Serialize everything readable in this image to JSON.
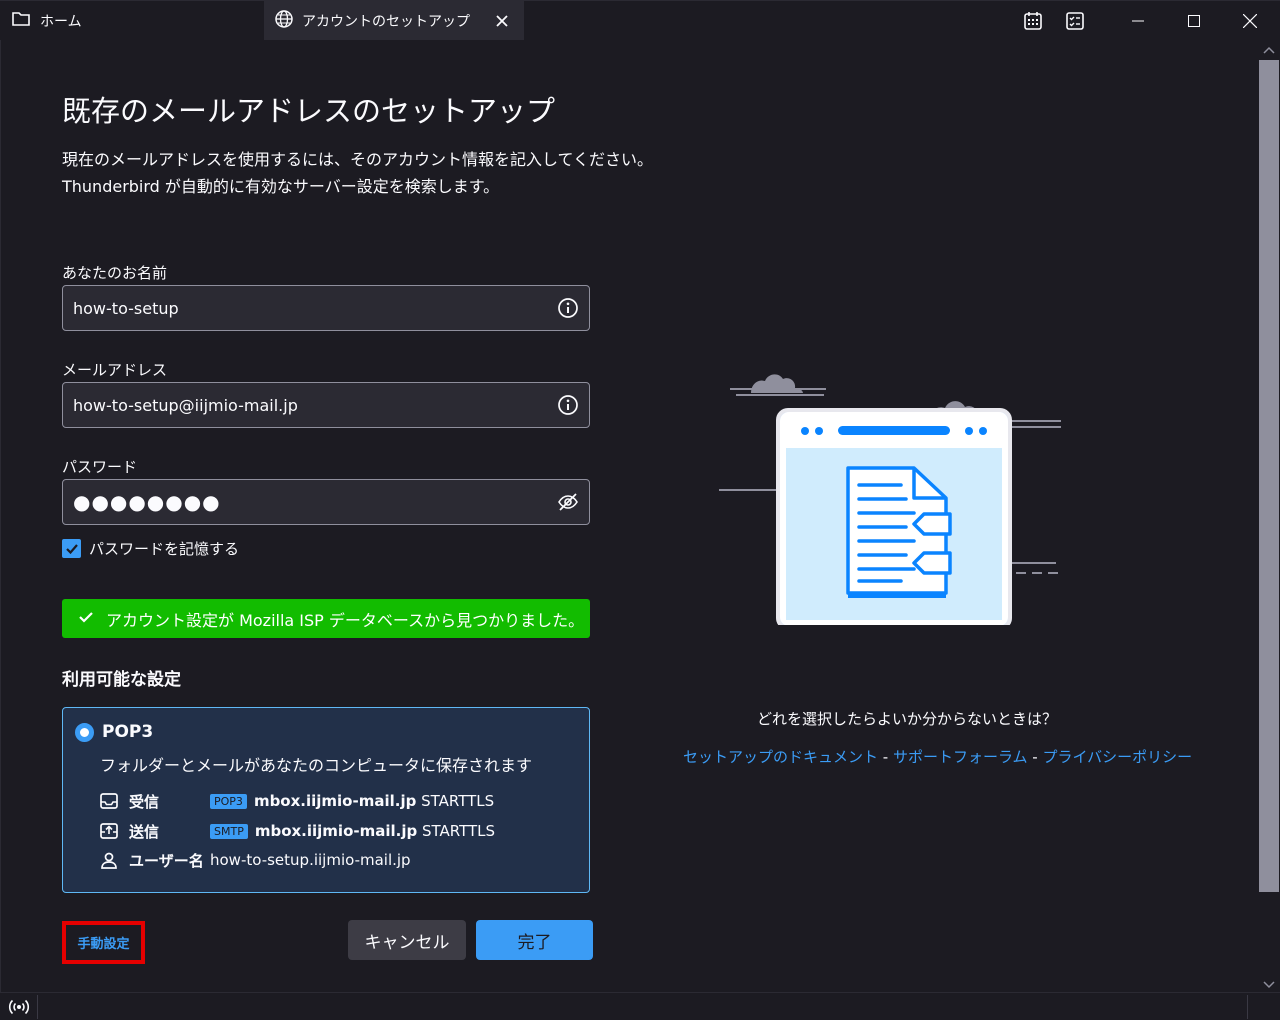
{
  "window": {
    "tabs": [
      {
        "label": "ホーム",
        "icon": "folder-icon"
      },
      {
        "label": "アカウントのセットアップ",
        "icon": "globe-icon"
      }
    ]
  },
  "page": {
    "title": "既存のメールアドレスのセットアップ",
    "intro_line1": "現在のメールアドレスを使用するには、そのアカウント情報を記入してください。",
    "intro_line2": "Thunderbird が自動的に有効なサーバー設定を検索します。"
  },
  "form": {
    "name_label": "あなたのお名前",
    "name_value": "how-to-setup",
    "email_label": "メールアドレス",
    "email_value": "how-to-setup@iijmio-mail.jp",
    "password_label": "パスワード",
    "password_value": "●●●●●●●●",
    "remember_label": "パスワードを記憶する",
    "remember_checked": true
  },
  "banner": {
    "text": "アカウント設定が Mozilla ISP データベースから見つかりました。",
    "color": "#12bc00"
  },
  "config": {
    "section_title": "利用可能な設定",
    "option_title": "POP3",
    "option_desc": "フォルダーとメールがあなたのコンピュータに保存されます",
    "incoming_label": "受信",
    "incoming_badge": "POP3",
    "incoming_host": "mbox.iijmio-mail.jp",
    "incoming_security": "STARTTLS",
    "outgoing_label": "送信",
    "outgoing_badge": "SMTP",
    "outgoing_host": "mbox.iijmio-mail.jp",
    "outgoing_security": "STARTTLS",
    "username_label": "ユーザー名",
    "username_value": "how-to-setup.iijmio-mail.jp"
  },
  "buttons": {
    "manual": "手動設定",
    "cancel": "キャンセル",
    "done": "完了"
  },
  "help": {
    "question": "どれを選択したらよいか分からないときは？",
    "link_docs": "セットアップのドキュメント",
    "link_forum": "サポートフォーラム",
    "link_privacy": "プライバシーポリシー",
    "separator": " - "
  },
  "colors": {
    "accent": "#3b9cf5",
    "background": "#1c1b22",
    "highlight_border": "#e50000"
  }
}
